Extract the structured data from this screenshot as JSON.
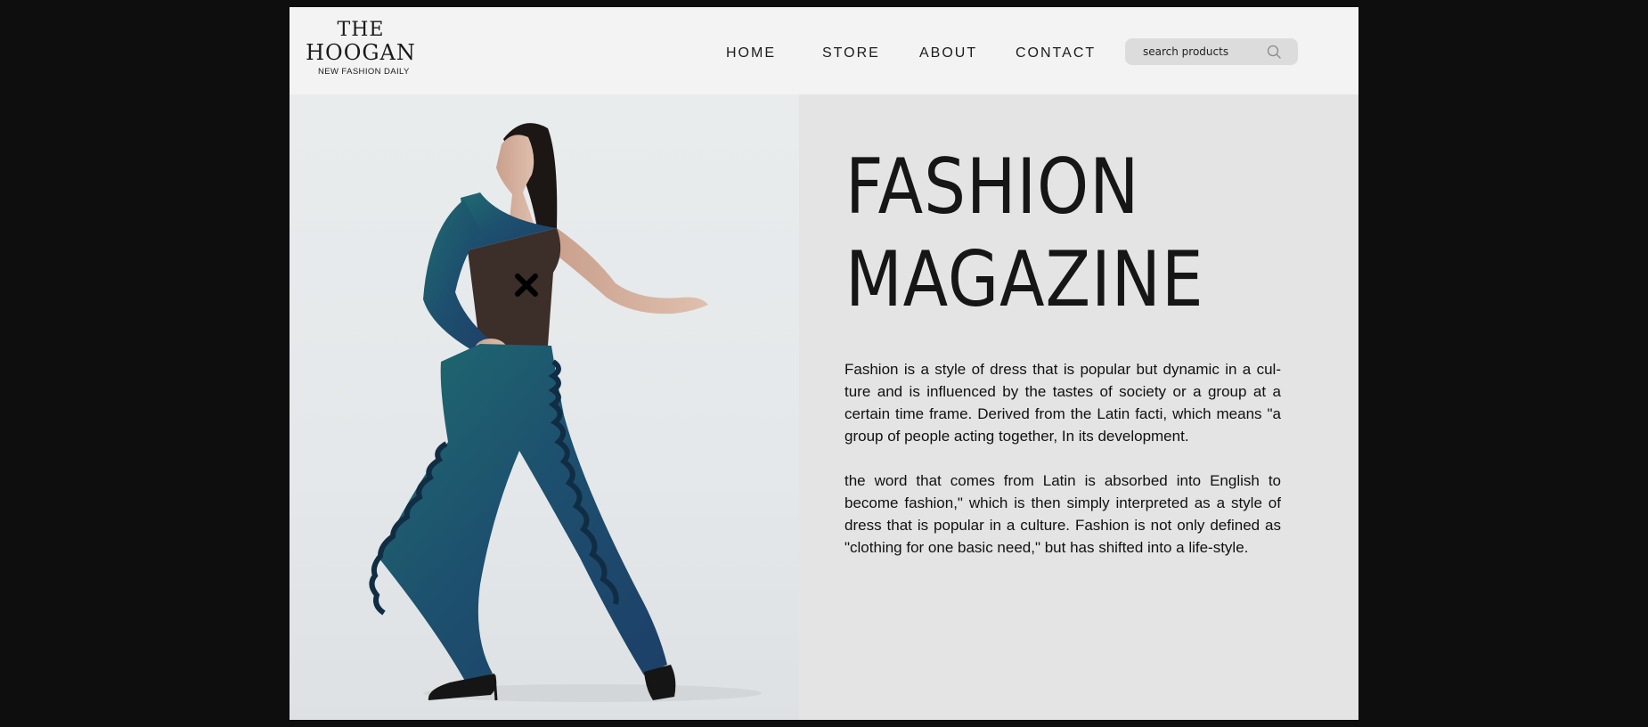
{
  "brand": {
    "logo_line1": "THE",
    "logo_line2": "HOOGAN",
    "tagline": "NEW FASHION DAILY"
  },
  "nav": {
    "items": [
      {
        "label": "HOME"
      },
      {
        "label": "STORE"
      },
      {
        "label": "ABOUT"
      },
      {
        "label": "CONTACT"
      }
    ]
  },
  "search": {
    "placeholder": "search products",
    "icon": "search-icon"
  },
  "hero": {
    "image": "model-in-teal-jumpsuit",
    "headline_line1": "FASHION",
    "headline_line2": "MAGAZINE",
    "paragraphs": [
      "Fashion is a style of dress that is popular but dynamic in a cul-ture and is influenced by the tastes of society or a group at a certain time frame. Derived from the Latin facti, which means \"a group of people acting together, In its development.",
      "the word that comes from Latin is absorbed into English to become fashion,\" which is then simply interpreted as a style of dress that is popular in a culture. Fashion is not only defined as \"clothing for one basic need,\" but has shifted into a life-style."
    ]
  },
  "colors": {
    "page_background": "#0e0e0e",
    "header_background": "#f3f3f3",
    "content_background": "#e4e4e4",
    "text": "#161616",
    "outfit_accent": "#1f5a6b"
  }
}
